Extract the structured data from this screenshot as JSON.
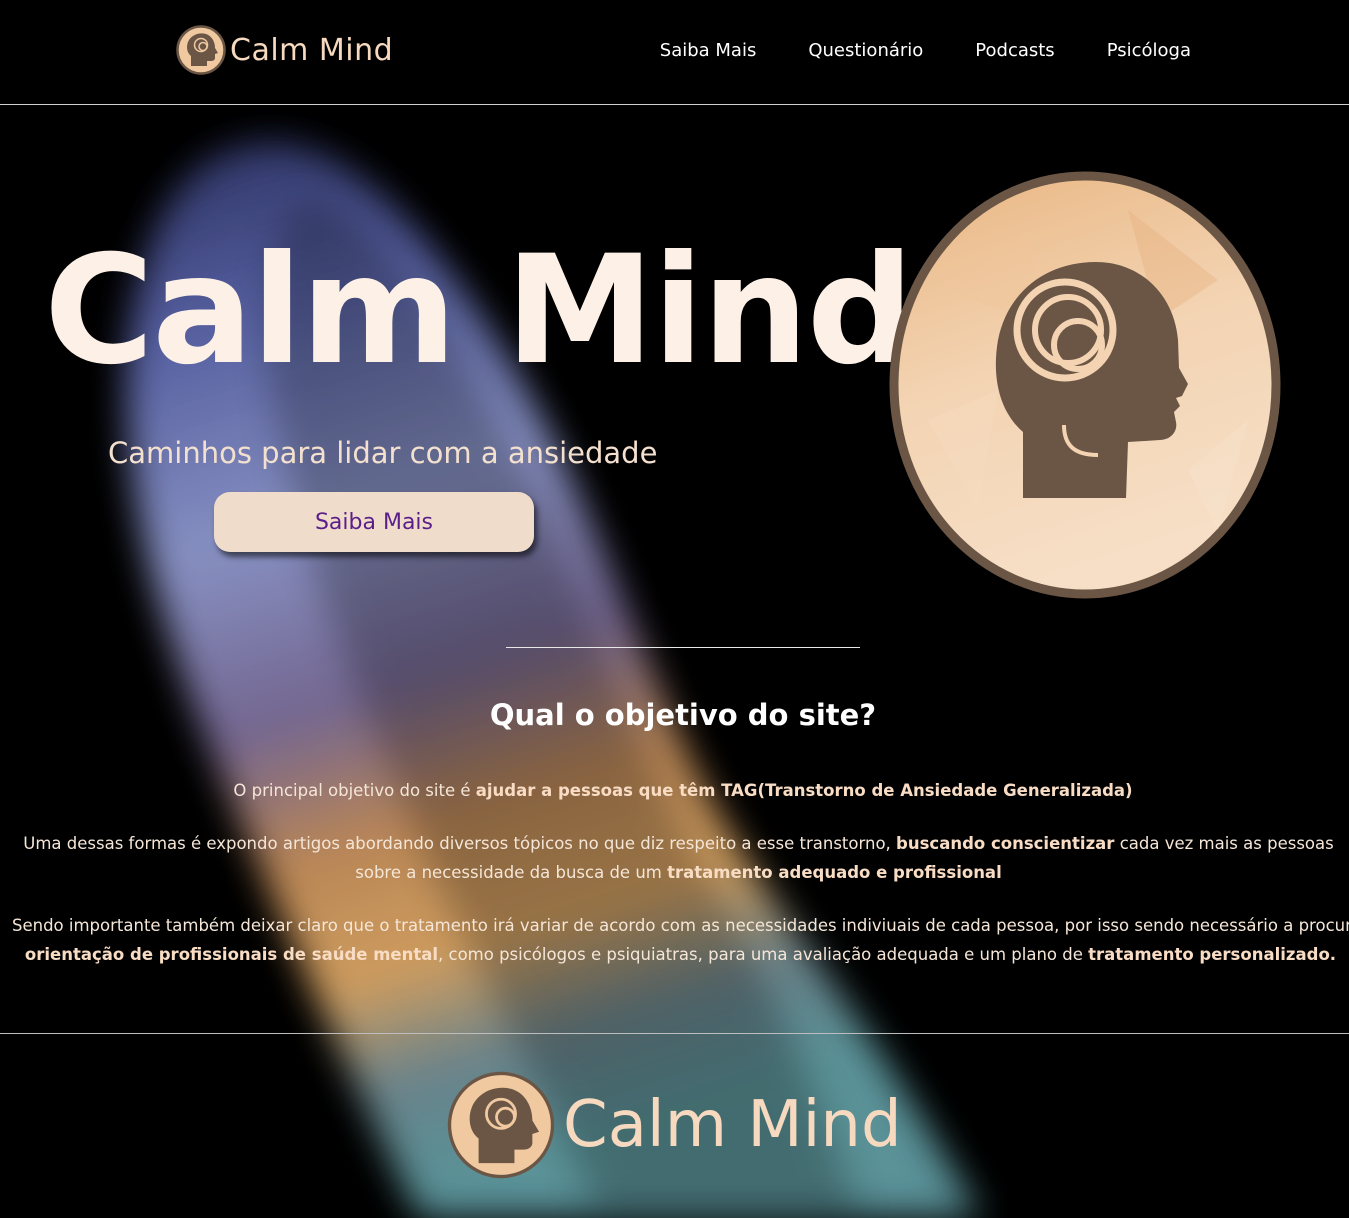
{
  "header": {
    "brand_name": "Calm Mind",
    "nav": [
      {
        "label": "Saiba Mais"
      },
      {
        "label": "Questionário"
      },
      {
        "label": "Podcasts"
      },
      {
        "label": "Psicóloga"
      }
    ]
  },
  "hero": {
    "title": "Calm Mind",
    "subtitle": "Caminhos para lidar com a ansiedade",
    "button_label": "Saiba Mais",
    "logo_icon": "head-spiral-logo"
  },
  "about": {
    "title": "Qual o objetivo do site?",
    "p1_a": "O principal objetivo do site é ",
    "p1_b": "ajudar a pessoas que têm TAG(Transtorno de Ansiedade Generalizada)",
    "p2_a": "Uma dessas formas é expondo artigos abordando diversos tópicos no que diz respeito a esse transtorno, ",
    "p2_b": "buscando conscientizar",
    "p2_c": " cada vez mais as pessoas sobre a necessidade da busca de um ",
    "p2_d": "tratamento adequado e profissional",
    "p3_a": "Sendo importante também deixar claro que o tratamento irá variar de acordo com as necessidades indiviuais de cada pessoa, por isso sendo necessário a procura por",
    "p3_b": "orientação de profissionais de saúde mental",
    "p3_c": ", como psicólogos e psiquiatras, para uma avaliação adequada e um plano de ",
    "p3_d": "tratamento personalizado."
  },
  "footer": {
    "brand_name": "Calm Mind"
  },
  "colors": {
    "background": "#000000",
    "accent_cream": "#f6d9bf",
    "logo_brown": "#6b5646",
    "button_bg": "#f0dccb",
    "button_text": "#5a1e8a"
  }
}
